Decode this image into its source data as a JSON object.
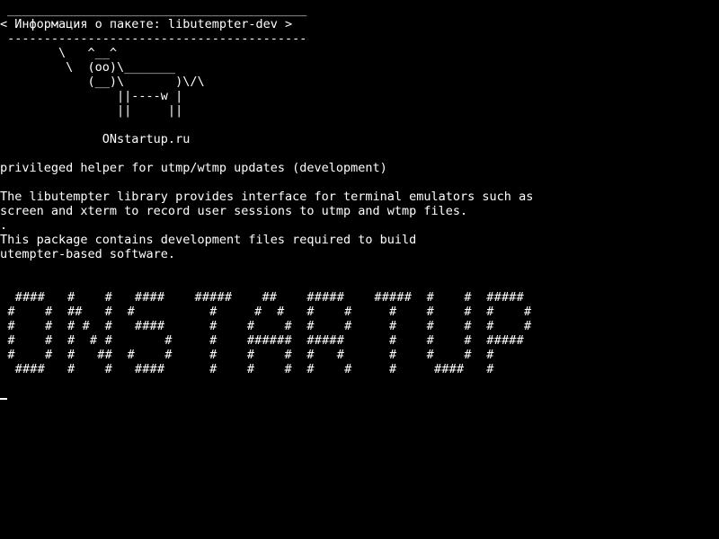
{
  "terminal": {
    "speech_border_top": " _________________________________________",
    "speech_text": "< Информация о пакете: libutempter-dev >",
    "speech_border_bottom": " -----------------------------------------",
    "cow_lines": [
      "        \\   ^__^",
      "         \\  (oo)\\_______",
      "            (__)\\       )\\/\\",
      "                ||----w |",
      "                ||     ||"
    ],
    "site": "              ONstartup.ru",
    "summary": "privileged helper for utmp/wtmp updates (development)",
    "description_lines": [
      "The libutempter library provides interface for terminal emulators such as",
      "screen and xterm to record user sessions to utmp and wtmp files.",
      ".",
      "This package contains development files required to build",
      "utempter-based software."
    ],
    "banner_lines": [
      "  ####   #    #   ####    #####    ##    #####    #####  #    #  #####",
      " #    #  ##   #  #          #     #  #   #    #     #    #    #  #    #",
      " #    #  # #  #   ####      #    #    #  #    #     #    #    #  #    #",
      " #    #  #  # #       #     #    ######  #####      #    #    #  #####",
      " #    #  #   ##  #    #     #    #    #  #   #      #    #    #  #",
      "  ####   #    #   ####      #    #    #  #    #     #     ####   #"
    ]
  }
}
